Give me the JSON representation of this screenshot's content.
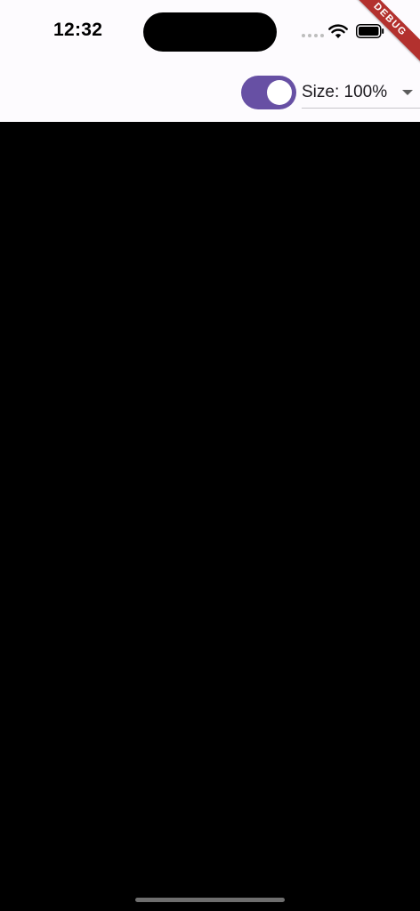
{
  "status_bar": {
    "time": "12:32"
  },
  "debug_banner": {
    "label": "DEBUG"
  },
  "app_bar": {
    "toggle": {
      "state": "on",
      "color": "#6750A4"
    },
    "size_dropdown": {
      "selected": "Size: 100%"
    }
  },
  "colors": {
    "accent": "#6750A4",
    "background": "#000000",
    "app_bar_bg": "#FDFBFE",
    "debug_banner": "#B3312E"
  },
  "icons": [
    "wifi-icon",
    "battery-icon",
    "chevron-down-icon"
  ]
}
